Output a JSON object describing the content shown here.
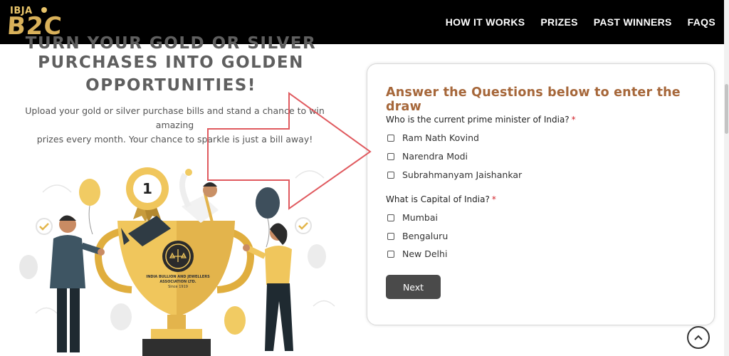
{
  "brand": {
    "logo_small": "IBJA",
    "logo_big": "B2C"
  },
  "nav": {
    "items": [
      {
        "label": "HOW IT WORKS"
      },
      {
        "label": "PRIZES"
      },
      {
        "label": "PAST WINNERS"
      },
      {
        "label": "FAQS"
      }
    ]
  },
  "hero": {
    "title_line0": "TURN YOUR GOLD OR SILVER",
    "title_line1": "PURCHASES INTO GOLDEN",
    "title_line2": "OPPORTUNITIES!",
    "desc_line1": "Upload your gold or silver purchase bills and stand a chance to win amazing",
    "desc_line2": "prizes every month. Your chance to sparkle is just a bill away!"
  },
  "illustration": {
    "trophy_badge_number": "1",
    "seal_line1": "INDIA BULLION AND JEWELLERS",
    "seal_line2": "ASSOCIATION LTD.",
    "seal_line3": "Since 1919"
  },
  "form": {
    "title": "Answer the Questions below to enter the draw",
    "questions": [
      {
        "label": "Who is the current prime minister of India?",
        "required_mark": "*",
        "options": [
          "Ram Nath Kovind",
          "Narendra Modi",
          "Subrahmanyam Jaishankar"
        ]
      },
      {
        "label": "What is Capital of India?",
        "required_mark": "*",
        "options": [
          "Mumbai",
          "Bengaluru",
          "New Delhi"
        ]
      }
    ],
    "next_label": "Next"
  },
  "colors": {
    "nav_bg": "#000000",
    "brand_gold": "#d9b15a",
    "form_title": "#a6673a",
    "required": "#d2232a",
    "button_bg": "#4a4a4a",
    "annotation_arrow": "#e05a5f"
  },
  "icons": {
    "scroll_top": "chevron-up-icon",
    "checkbox": "checkbox-icon"
  }
}
